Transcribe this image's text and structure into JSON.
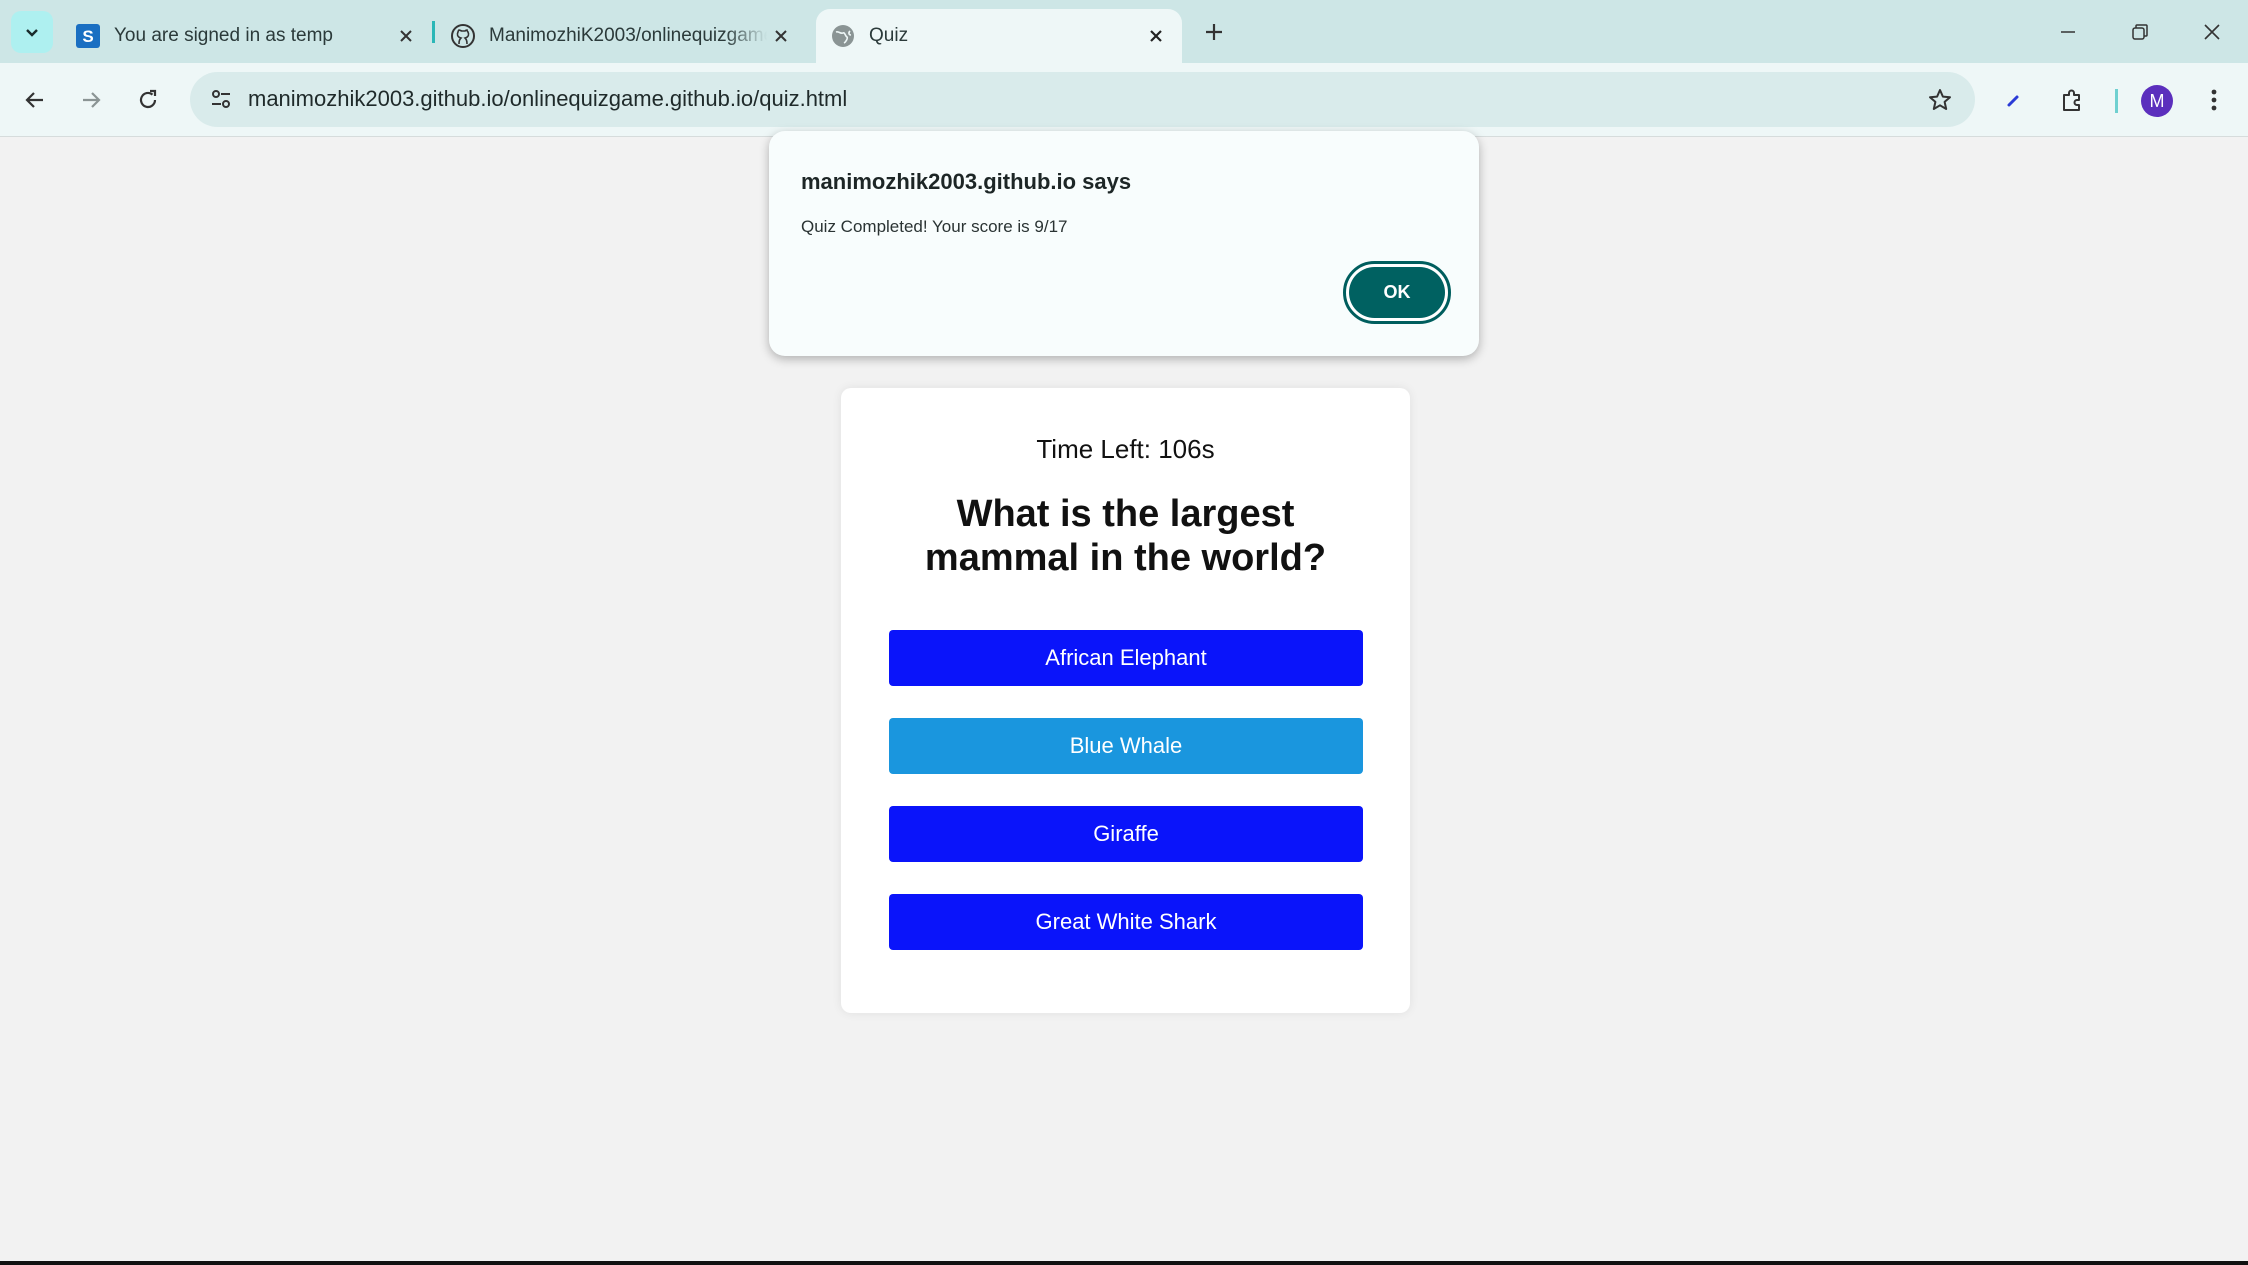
{
  "browser": {
    "tabs": [
      {
        "title": "You are signed in as temp",
        "icon": "s-logo-icon"
      },
      {
        "title": "ManimozhiK2003/onlinequizgame",
        "icon": "github-icon"
      },
      {
        "title": "Quiz",
        "icon": "globe-icon"
      }
    ],
    "active_tab": 2,
    "url": "manimozhik2003.github.io/onlinequizgame.github.io/quiz.html",
    "profile_initial": "M",
    "colors": {
      "tabstrip": "#cde6e6",
      "toolbar": "#eef7f7",
      "avatar": "#5b2fbd"
    }
  },
  "dialog": {
    "title": "manimozhik2003.github.io says",
    "message": "Quiz Completed! Your score is 9/17",
    "ok_label": "OK",
    "accent": "#006161"
  },
  "quiz": {
    "timer": "Time Left: 106s",
    "question": "What is the largest mammal in the world?",
    "options": [
      {
        "label": "African Elephant",
        "color": "#0a14fa"
      },
      {
        "label": "Blue Whale",
        "color": "#1a96de"
      },
      {
        "label": "Giraffe",
        "color": "#0a14fa"
      },
      {
        "label": "Great White Shark",
        "color": "#0a14fa"
      }
    ]
  }
}
